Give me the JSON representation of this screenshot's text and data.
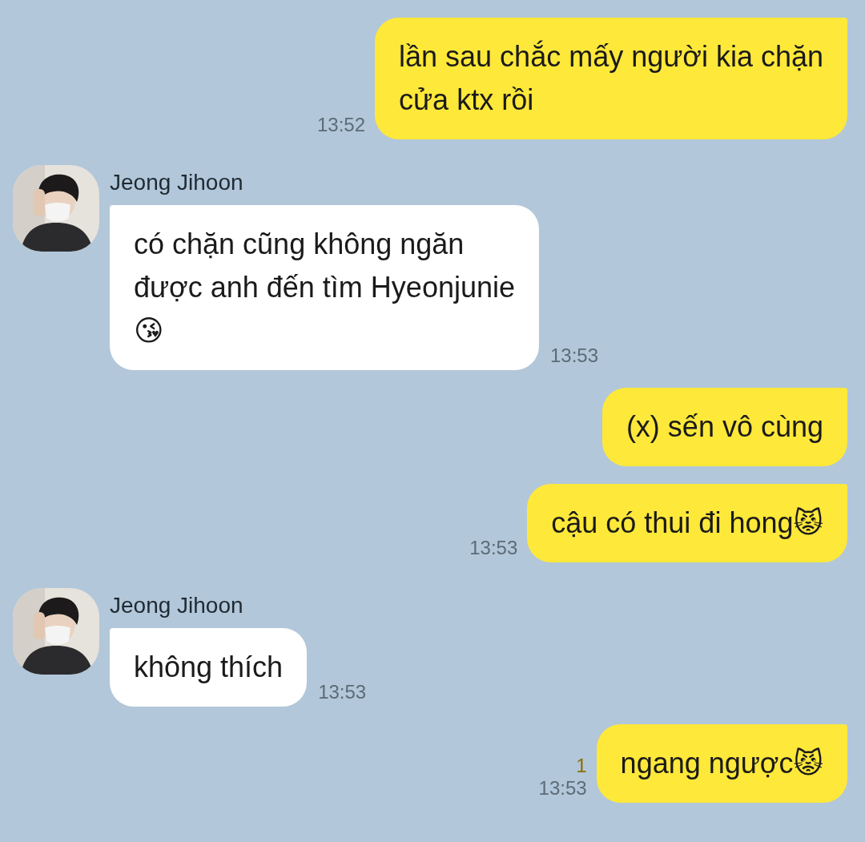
{
  "messages": [
    {
      "kind": "sent",
      "text": "lần sau chắc mấy người kia chặn\ncửa ktx rồi",
      "time": "13:52"
    },
    {
      "kind": "received",
      "sender": "Jeong Jihoon",
      "text": "có chặn cũng không ngăn\nđược anh đến tìm Hyeonjunie\n😘",
      "time": "13:53"
    },
    {
      "kind": "sent",
      "text": "(x) sến vô cùng"
    },
    {
      "kind": "sent",
      "text": "cậu có thui đi hong😾",
      "time": "13:53"
    },
    {
      "kind": "received",
      "sender": "Jeong Jihoon",
      "text": "không thích",
      "time": "13:53"
    },
    {
      "kind": "sent",
      "text": "ngang ngược😾",
      "time": "13:53",
      "unread": "1"
    }
  ]
}
